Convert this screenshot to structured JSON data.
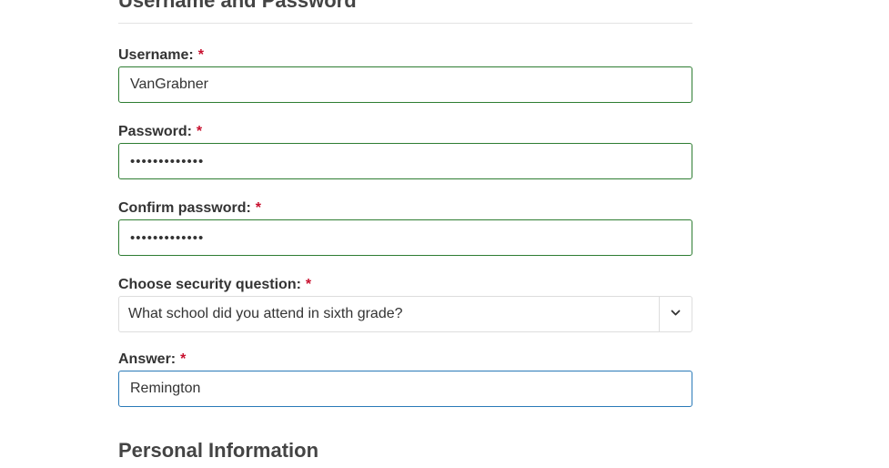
{
  "sections": {
    "account_heading": "Username and Password",
    "personal_heading": "Personal Information"
  },
  "required_marker": "*",
  "form": {
    "username": {
      "label": "Username:",
      "value": "VanGrabner"
    },
    "password": {
      "label": "Password:",
      "value": "•••••••••••••"
    },
    "confirm_password": {
      "label": "Confirm password:",
      "value": "•••••••••••••"
    },
    "security_question": {
      "label": "Choose security question:",
      "selected": "What school did you attend in sixth grade?",
      "icon": "chevron-down-icon"
    },
    "answer": {
      "label": "Answer:",
      "value": "Remington"
    }
  },
  "colors": {
    "valid_border": "#2e7d32",
    "focus_border": "#2a7ab8",
    "required_marker": "#c8102e"
  }
}
